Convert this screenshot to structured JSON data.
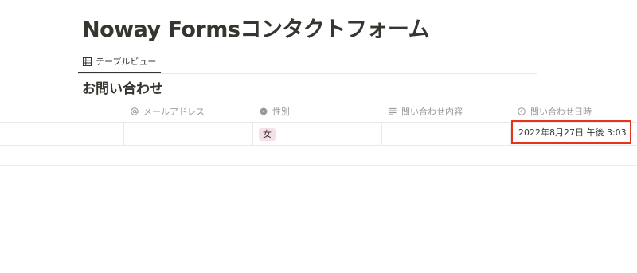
{
  "page": {
    "title": "Noway Formsコンタクトフォーム"
  },
  "view_tabs": [
    {
      "label": "テーブルビュー",
      "icon": "table-icon",
      "active": true
    }
  ],
  "database": {
    "title": "お問い合わせ",
    "columns": [
      {
        "label": "メールアドレス",
        "icon": "at-icon"
      },
      {
        "label": "性別",
        "icon": "select-icon"
      },
      {
        "label": "問い合わせ内容",
        "icon": "text-lines-icon"
      },
      {
        "label": "問い合わせ日時",
        "icon": "clock-icon"
      }
    ],
    "rows": [
      {
        "title": "",
        "email": "",
        "gender": "女",
        "content": "",
        "datetime": "2022年8月27日 午後 3:03"
      }
    ]
  },
  "colors": {
    "text": "#37352f",
    "muted": "#9b9a97",
    "divider": "#e9e9e7",
    "tag_pink": "#f5e0e9",
    "highlight": "#e8321c"
  }
}
